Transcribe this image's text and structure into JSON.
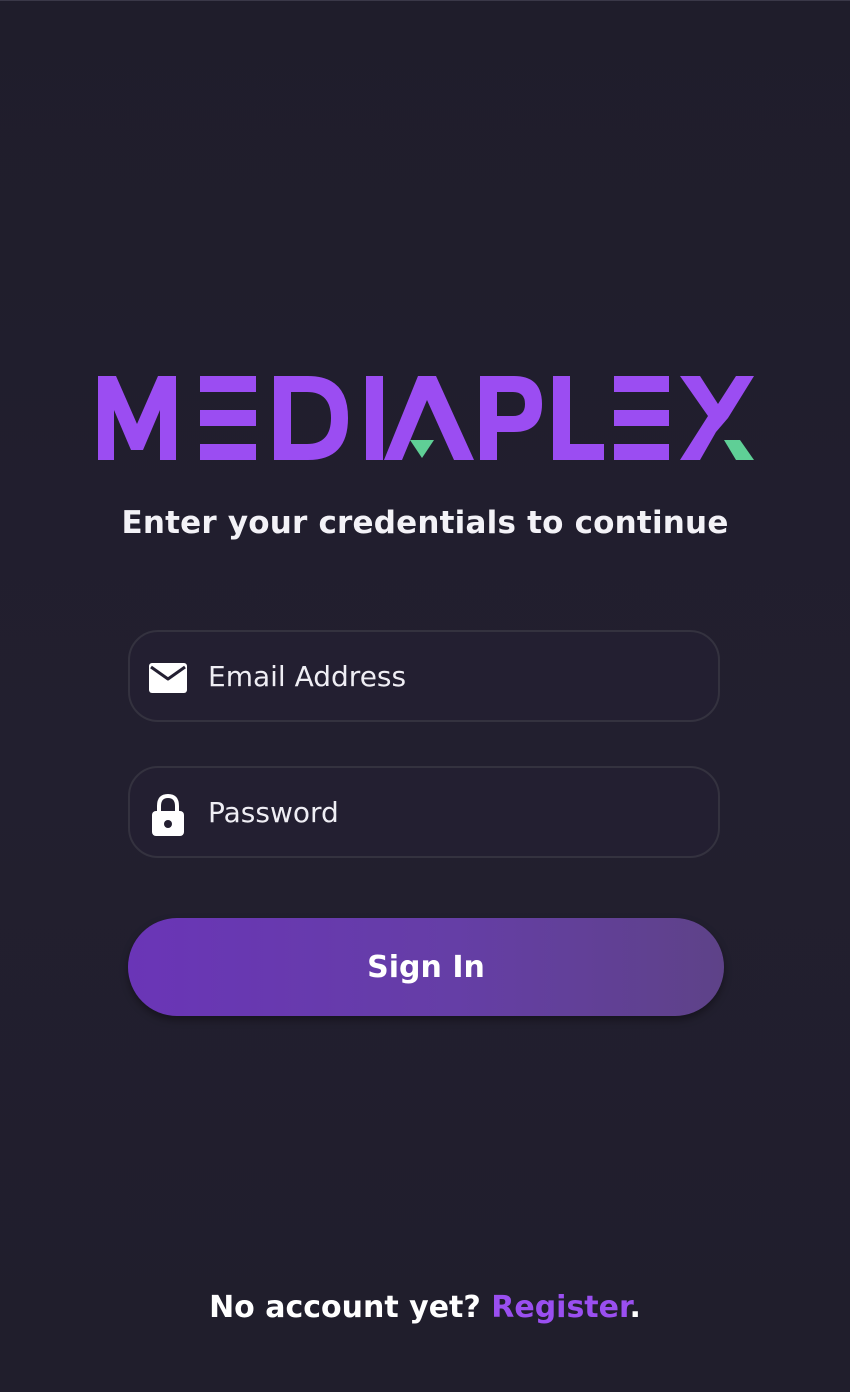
{
  "brand": {
    "name": "MEDIAPLEX",
    "primary_color": "#9b4df2",
    "accent_color": "#5fcf96"
  },
  "login": {
    "subtitle": "Enter your credentials to continue",
    "email": {
      "placeholder": "Email Address",
      "value": "",
      "icon": "envelope-icon"
    },
    "password": {
      "placeholder": "Password",
      "value": "",
      "icon": "lock-icon"
    },
    "submit_label": "Sign In"
  },
  "footer": {
    "prompt": "No account yet? ",
    "link_label": "Register",
    "suffix": "."
  }
}
